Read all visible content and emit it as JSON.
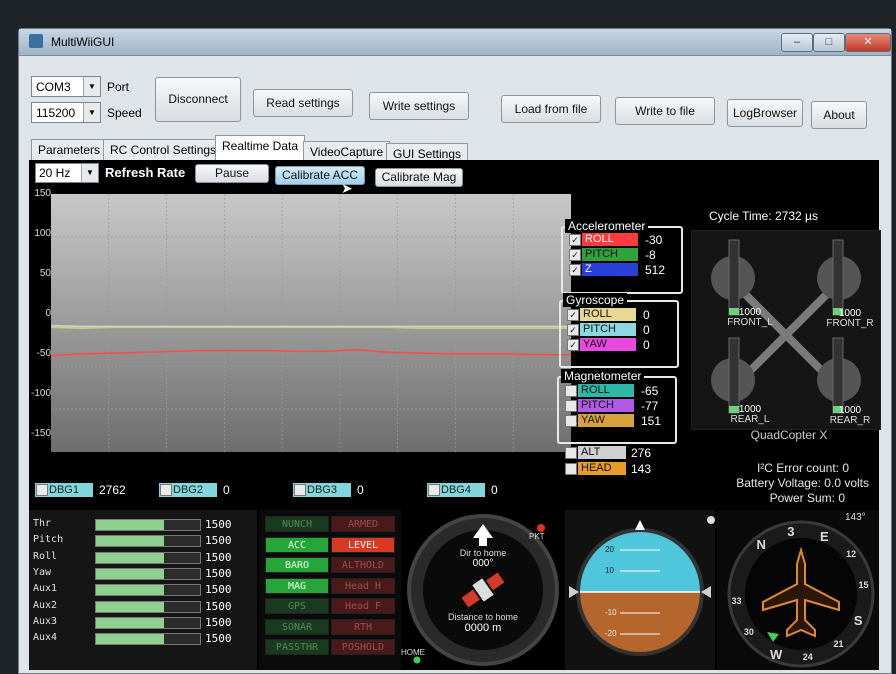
{
  "window": {
    "title": "MultiWiiGUI",
    "buttons": {
      "minimize": "–",
      "maximize": "□",
      "close": "✕"
    }
  },
  "connection": {
    "port_value": "COM3",
    "port_label": "Port",
    "speed_value": "115200",
    "speed_label": "Speed",
    "disconnect_label": "Disconnect"
  },
  "toolbar": {
    "read_settings": "Read settings",
    "write_settings": "Write settings",
    "load_from_file": "Load from file",
    "write_to_file": "Write to file",
    "log_browser": "LogBrowser",
    "about": "About"
  },
  "tabs": [
    "Parameters",
    "RC Control Settings",
    "Realtime Data",
    "VideoCapture",
    "GUI Settings"
  ],
  "realtime": {
    "refresh_value": "20 Hz",
    "refresh_label": "Refresh Rate",
    "pause_label": "Pause",
    "calib_acc_label": "Calibrate ACC",
    "calib_mag_label": "Calibrate Mag",
    "cycle_time": "Cycle Time:  2732 µs"
  },
  "chart_data": {
    "type": "line",
    "ylim": [
      -150,
      150
    ],
    "y_ticks": [
      "150",
      "100",
      "50",
      "0",
      "-50",
      "-100",
      "-150"
    ],
    "grid": true,
    "series": [
      {
        "name": "ROLL",
        "color": "#ff4a4a",
        "values": [
          -38,
          -36,
          -35,
          -34,
          -33,
          -32,
          -32,
          -32,
          -33,
          -33,
          -31,
          -34,
          -35,
          -36,
          -36,
          -36,
          -37,
          -37
        ]
      },
      {
        "name": "PITCH",
        "color": "#cfcf6a",
        "values": [
          -5,
          -6,
          -5,
          -5,
          -5,
          -5,
          -5,
          -5,
          -5,
          -5,
          -5,
          -5,
          -6,
          -6,
          -6,
          -6,
          -6,
          -6
        ]
      },
      {
        "name": "Z",
        "color": "#d0d0d0",
        "values": [
          -3,
          -4,
          -4,
          -4,
          -4,
          -4,
          -4,
          -4,
          -4,
          -4,
          -4,
          -4,
          -4,
          -4,
          -4,
          -4,
          -4,
          -4
        ]
      }
    ]
  },
  "accelerometer": {
    "title": "Accelerometer",
    "items": [
      {
        "name": "ROLL",
        "value": "-30",
        "color": "#ff3b3b",
        "checked": true
      },
      {
        "name": "PITCH",
        "value": "-8",
        "color": "#2fa33a",
        "checked": true
      },
      {
        "name": "Z",
        "value": "512",
        "color": "#2a3fd6",
        "checked": true
      }
    ]
  },
  "gyroscope": {
    "title": "Gyroscope",
    "items": [
      {
        "name": "ROLL",
        "value": "0",
        "color": "#e8d890",
        "checked": true
      },
      {
        "name": "PITCH",
        "value": "0",
        "color": "#8ad8e0",
        "checked": true
      },
      {
        "name": "YAW",
        "value": "0",
        "color": "#e84ae0",
        "checked": true
      }
    ]
  },
  "magnetometer": {
    "title": "Magnetometer",
    "items": [
      {
        "name": "ROLL",
        "value": "-65",
        "color": "#2fb8a8",
        "checked": false
      },
      {
        "name": "PITCH",
        "value": "-77",
        "color": "#b05ae6",
        "checked": false
      },
      {
        "name": "YAW",
        "value": "151",
        "color": "#d9a23a",
        "checked": false
      }
    ]
  },
  "extra": [
    {
      "name": "ALT",
      "value": "276",
      "color": "#d0d0d0"
    },
    {
      "name": "HEAD",
      "value": "143",
      "color": "#e89a2a"
    }
  ],
  "debug": [
    {
      "name": "DBG1",
      "value": "2762"
    },
    {
      "name": "DBG2",
      "value": "0"
    },
    {
      "name": "DBG3",
      "value": "0"
    },
    {
      "name": "DBG4",
      "value": "0"
    }
  ],
  "quad": {
    "type": "QuadCopter X",
    "motors": [
      {
        "name": "FRONT_L",
        "value": "1000"
      },
      {
        "name": "FRONT_R",
        "value": "1000"
      },
      {
        "name": "REAR_L",
        "value": "1000"
      },
      {
        "name": "REAR_R",
        "value": "1000"
      }
    ]
  },
  "status": {
    "i2c": "I²C Error count:  0",
    "battery": "Battery Voltage:  0.0 volts",
    "power": "Power Sum:  0"
  },
  "rc": [
    {
      "name": "Thr",
      "value": "1500",
      "level": 0.5
    },
    {
      "name": "Pitch",
      "value": "1500",
      "level": 0.5
    },
    {
      "name": "Roll",
      "value": "1500",
      "level": 0.5
    },
    {
      "name": "Yaw",
      "value": "1500",
      "level": 0.5
    },
    {
      "name": "Aux1",
      "value": "1500",
      "level": 0.5
    },
    {
      "name": "Aux2",
      "value": "1500",
      "level": 0.5
    },
    {
      "name": "Aux3",
      "value": "1500",
      "level": 0.5
    },
    {
      "name": "Aux4",
      "value": "1500",
      "level": 0.5
    }
  ],
  "modes_left": [
    {
      "name": "NUNCH",
      "state": "off"
    },
    {
      "name": "ACC",
      "state": "on"
    },
    {
      "name": "BARO",
      "state": "on"
    },
    {
      "name": "MAG",
      "state": "on"
    },
    {
      "name": "GPS",
      "state": "off"
    },
    {
      "name": "SONAR",
      "state": "off"
    },
    {
      "name": "PASSTHR",
      "state": "off"
    }
  ],
  "modes_right": [
    {
      "name": "ARMED",
      "state": "off"
    },
    {
      "name": "LEVEL",
      "state": "on"
    },
    {
      "name": "ALTHOLD",
      "state": "off"
    },
    {
      "name": "Head H",
      "state": "off"
    },
    {
      "name": "Head F",
      "state": "off"
    },
    {
      "name": "RTH",
      "state": "off"
    },
    {
      "name": "POSHOLD",
      "state": "off"
    }
  ],
  "gps": {
    "dir_label": "Dir to home",
    "dir_value": "000°",
    "dist_label": "Distance to home",
    "dist_value": "0000 m",
    "home_label": "HOME",
    "pkt_label": "PKT"
  },
  "horizon": {
    "ticks": [
      "20",
      "10",
      "-10",
      "-20"
    ]
  },
  "compass": {
    "heading": "143°",
    "marks": [
      "N",
      "3",
      "E",
      "12",
      "15",
      "S",
      "21",
      "24",
      "W",
      "30",
      "33"
    ]
  }
}
